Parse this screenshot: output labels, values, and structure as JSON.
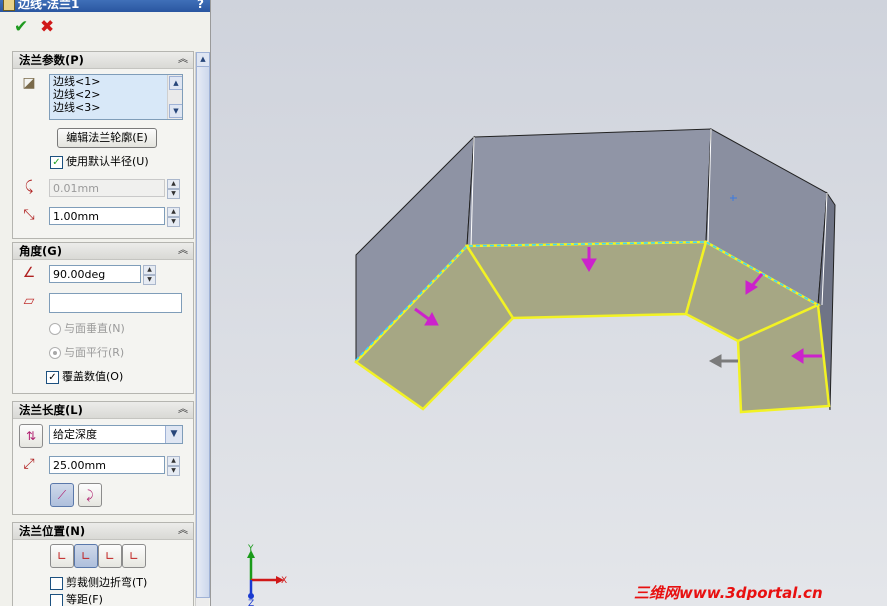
{
  "window": {
    "title": "边线-法兰1",
    "help": "?"
  },
  "actions": {
    "ok_icon": "check-icon",
    "cancel_icon": "x-icon"
  },
  "flange_params": {
    "header": "法兰参数(P)",
    "edges": [
      "边线<1>",
      "边线<2>",
      "边线<3>"
    ],
    "edit_profile_button": "编辑法兰轮廓(E)",
    "use_default_radius": {
      "label": "使用默认半径(U)",
      "checked": true
    },
    "bend_radius": {
      "value": "0.01mm",
      "disabled": true
    },
    "gap": {
      "value": "1.00mm"
    }
  },
  "angle": {
    "header": "角度(G)",
    "value": "90.00deg",
    "reference_value": "",
    "perpendicular_label": "与面垂直(N)",
    "parallel_label": "与面平行(R)",
    "override_label": "覆盖数值(O)",
    "override_checked": true
  },
  "length": {
    "header": "法兰长度(L)",
    "end_condition": "给定深度",
    "value": "25.00mm"
  },
  "position": {
    "header": "法兰位置(N)",
    "trim_side_bends_label": "剪裁侧边折弯(T)",
    "offset_label": "等距(F)"
  },
  "triad": {
    "x": "X",
    "y": "Y",
    "z": "Z"
  },
  "watermark": "三维网www.3dportal.cn",
  "colors": {
    "selection": "#f2f224",
    "arrows": "#cc22cc",
    "part": "#8c91a3"
  }
}
